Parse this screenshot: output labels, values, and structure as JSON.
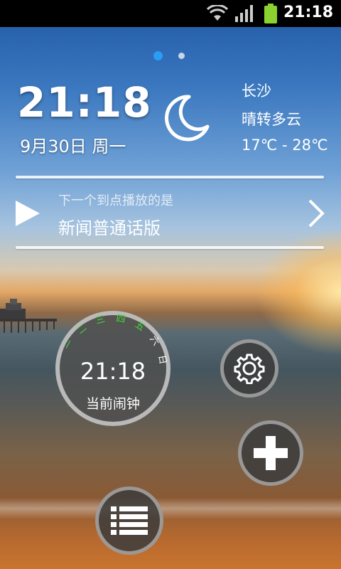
{
  "status_bar": {
    "time": "21:18"
  },
  "pager": {
    "active_index": 0,
    "count": 2
  },
  "clock": {
    "time": "21:18",
    "date": "9月30日 周一"
  },
  "weather": {
    "icon": "moon-icon",
    "city": "长沙",
    "condition": "晴转多云",
    "temperature": "17℃ - 28℃"
  },
  "next_broadcast": {
    "subtitle": "下一个到点播放的是",
    "title": "新闻普通话版"
  },
  "alarm": {
    "time": "21:18",
    "label": "当前闹钟",
    "weekdays": [
      {
        "label": "一",
        "active": true
      },
      {
        "label": "二",
        "active": true
      },
      {
        "label": "三",
        "active": true
      },
      {
        "label": "四",
        "active": true
      },
      {
        "label": "五",
        "active": true
      },
      {
        "label": "六",
        "active": false
      },
      {
        "label": "日",
        "active": false
      }
    ]
  },
  "buttons": {
    "settings": "gear-icon",
    "add": "plus-icon",
    "menu": "list-icon"
  },
  "colors": {
    "accent_blue": "#2a9df4",
    "weekday_active": "#3ddc3d",
    "weekday_inactive": "#ffffff"
  }
}
